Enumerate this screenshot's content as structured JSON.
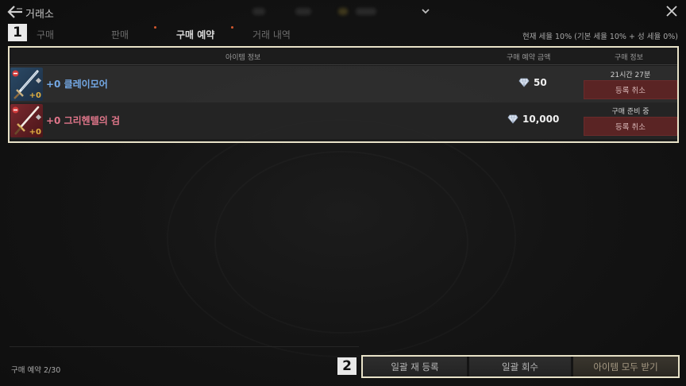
{
  "header": {
    "title": "거래소"
  },
  "tabs": {
    "marker": "1",
    "items": [
      {
        "label": "구매",
        "active": false
      },
      {
        "label": "판매",
        "active": false
      },
      {
        "label": "구매 예약",
        "active": true
      },
      {
        "label": "거래 내역",
        "active": false
      }
    ],
    "tax_info": "현재 세율 10% (기본 세율 10% + 성 세율 0%)"
  },
  "table": {
    "columns": {
      "item_info": "아이템 정보",
      "reserve_price": "구매 예약 금액",
      "purchase_info": "구매 정보"
    },
    "rows": [
      {
        "enhance": "+0",
        "name": "+0 클레이모어",
        "price": "50",
        "status": "21시간 27분",
        "cancel_label": "등록 취소"
      },
      {
        "enhance": "+0",
        "name": "+0 그리헨텔의 검",
        "price": "10,000",
        "status": "구매 준비 중",
        "cancel_label": "등록 취소"
      }
    ]
  },
  "footer": {
    "reservation_count": "구매 예약 2/30",
    "marker": "2",
    "buttons": {
      "re_register": "일괄 재 등록",
      "collect": "일괄 회수",
      "receive_all": "아이템 모두 받기"
    }
  },
  "colors": {
    "highlight_border": "#e8e2c8",
    "cancel_button": "#5a2424",
    "blue_item": "#74a9e6",
    "red_item": "#e0768a"
  },
  "icons": [
    "back-arrow-icon",
    "chevron-down-icon",
    "close-icon",
    "diamond-icon",
    "no-entry-icon",
    "sword-icon"
  ]
}
